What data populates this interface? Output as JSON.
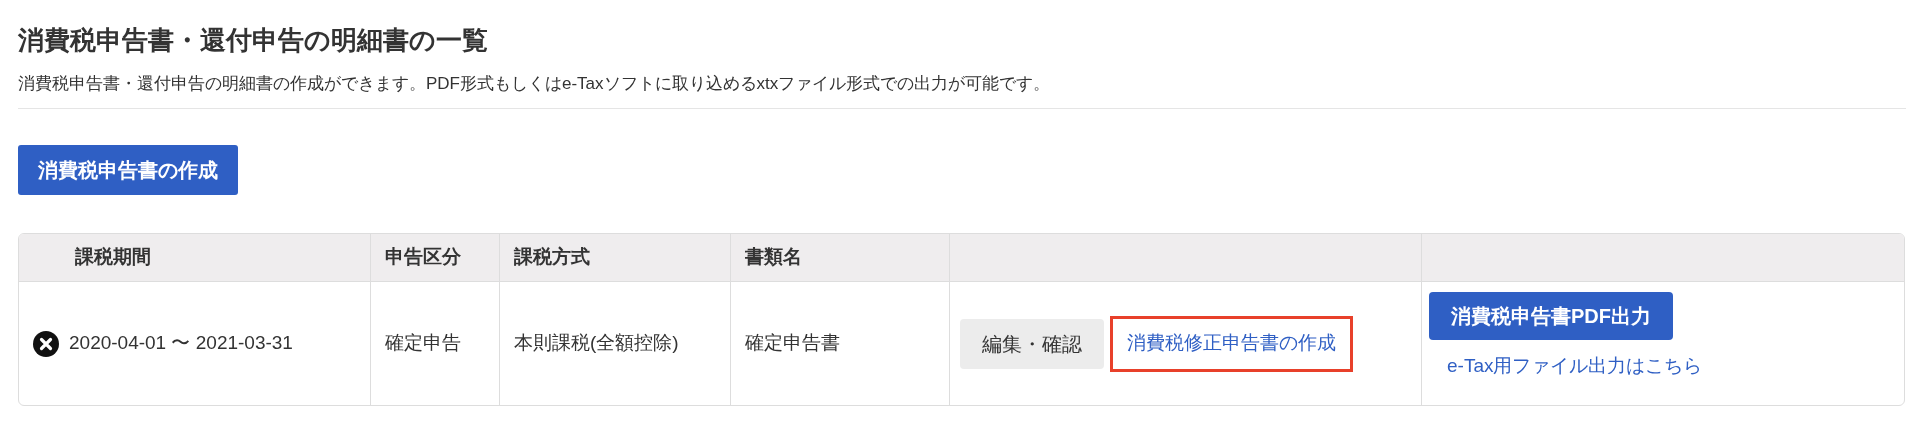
{
  "page": {
    "title": "消費税申告書・還付申告の明細書の一覧",
    "description": "消費税申告書・還付申告の明細書の作成ができます。PDF形式もしくはe-Taxソフトに取り込めるxtxファイル形式での出力が可能です。"
  },
  "create_button": "消費税申告書の作成",
  "table": {
    "columns": [
      "課税期間",
      "申告区分",
      "課税方式",
      "書類名"
    ],
    "rows": [
      {
        "period": "2020-04-01 〜 2021-03-31",
        "filing_type": "確定申告",
        "tax_method": "本則課税(全額控除)",
        "document": "確定申告書",
        "edit_button": "編集・確認",
        "revision_link": {
          "label": "消費税修正申告書の作成",
          "highlighted": true
        },
        "pdf_button": "消費税申告書PDF出力",
        "etax_link": "e-Tax用ファイル出力はこちら"
      }
    ]
  }
}
